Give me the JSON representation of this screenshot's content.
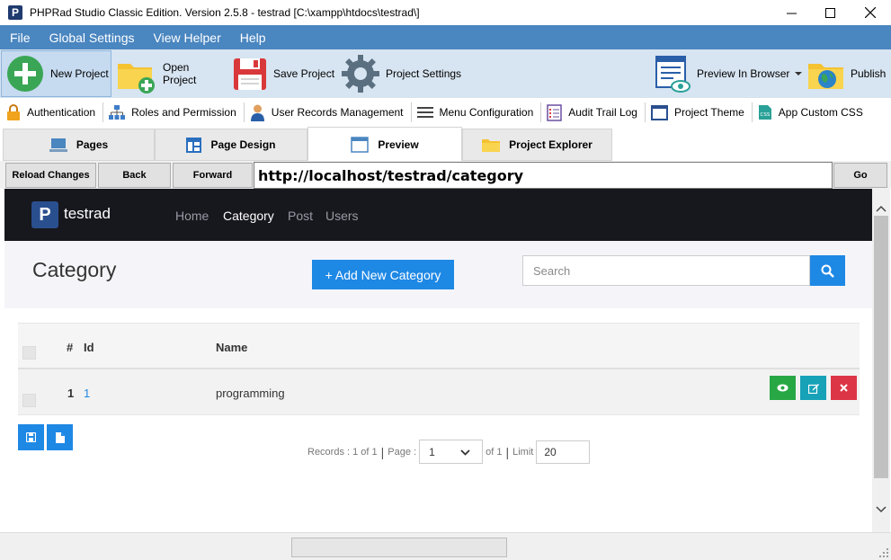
{
  "window": {
    "title": "PHPRad Studio Classic Edition.  Version 2.5.8 - testrad [C:\\xampp\\htdocs\\testrad\\]",
    "icon_letter": "P"
  },
  "menu": [
    "File",
    "Global Settings",
    "View Helper",
    "Help"
  ],
  "toolbar": {
    "new_project": "New Project",
    "open_project": "Open Project",
    "save_project": "Save Project",
    "project_settings": "Project Settings",
    "preview_in_browser": "Preview In Browser",
    "publish": "Publish"
  },
  "toolbar2": {
    "authentication": "Authentication",
    "roles": "Roles and Permission",
    "user_records": "User Records Management",
    "menu_config": "Menu Configuration",
    "audit_trail": "Audit Trail Log",
    "project_theme": "Project Theme",
    "custom_css": "App Custom CSS"
  },
  "tabs": {
    "pages": "Pages",
    "page_design": "Page Design",
    "preview": "Preview",
    "project_explorer": "Project Explorer",
    "active": "Preview"
  },
  "browser": {
    "reload": "Reload Changes",
    "back": "Back",
    "forward": "Forward",
    "url": "http://localhost/testrad/category",
    "go": "Go"
  },
  "site": {
    "brand_letter": "P",
    "brand": "testrad",
    "nav": {
      "home": "Home",
      "category": "Category",
      "post": "Post",
      "users": "Users"
    },
    "page_title": "Category",
    "add_button": "+ Add New Category",
    "search_placeholder": "Search",
    "table": {
      "headers": {
        "num": "#",
        "id": "Id",
        "name": "Name"
      },
      "rows": [
        {
          "num": "1",
          "id": "1",
          "name": "programming"
        }
      ]
    },
    "pager": {
      "records": "Records : 1 of 1",
      "page_label": "Page :",
      "page_value": "1",
      "of": "of 1",
      "limit_label": "Limit",
      "limit_value": "20"
    }
  },
  "colors": {
    "menubar": "#4a86c0",
    "toolbar": "#d7e4f1",
    "primary": "#1e88e5",
    "success": "#28a745",
    "info": "#17a2b8",
    "danger": "#dc3545",
    "site_nav": "#17171e"
  }
}
